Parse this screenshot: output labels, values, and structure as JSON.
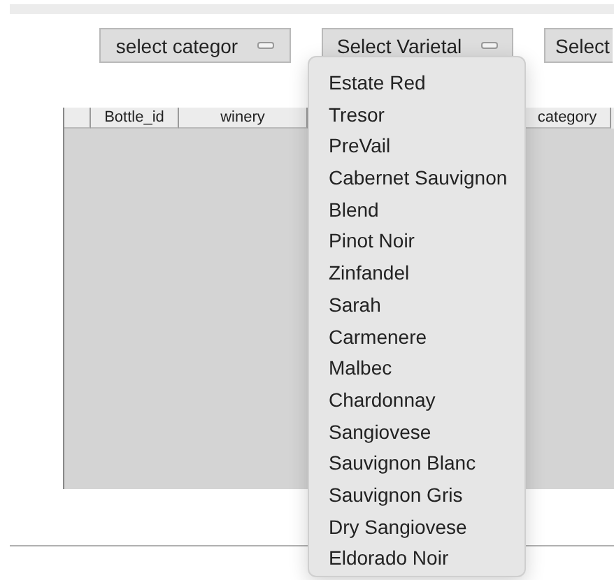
{
  "toolbar": {
    "buttons": [
      {
        "label": "select categor"
      },
      {
        "label": "Select Varietal"
      },
      {
        "label": "Select"
      }
    ]
  },
  "table": {
    "columns": [
      "Bottle_id",
      "winery",
      "category"
    ]
  },
  "popup_menu": {
    "items": [
      {
        "label": "Estate Red",
        "selected": false
      },
      {
        "label": "Tresor",
        "selected": false
      },
      {
        "label": "PreVail",
        "selected": false
      },
      {
        "label": "Cabernet Sauvignon",
        "selected": false
      },
      {
        "label": "Blend",
        "selected": false
      },
      {
        "label": "Pinot Noir",
        "selected": false
      },
      {
        "label": "Zinfandel",
        "selected": false
      },
      {
        "label": "Sarah",
        "selected": false
      },
      {
        "label": "Carmenere",
        "selected": false
      },
      {
        "label": "Malbec",
        "selected": false
      },
      {
        "label": "Chardonnay",
        "selected": false
      },
      {
        "label": "Sangiovese",
        "selected": false
      },
      {
        "label": "Sauvignon Blanc",
        "selected": false
      },
      {
        "label": "Sauvignon Gris",
        "selected": false
      },
      {
        "label": "Dry Sangiovese",
        "selected": false
      },
      {
        "label": "Eldorado Noir",
        "selected": false
      }
    ]
  }
}
